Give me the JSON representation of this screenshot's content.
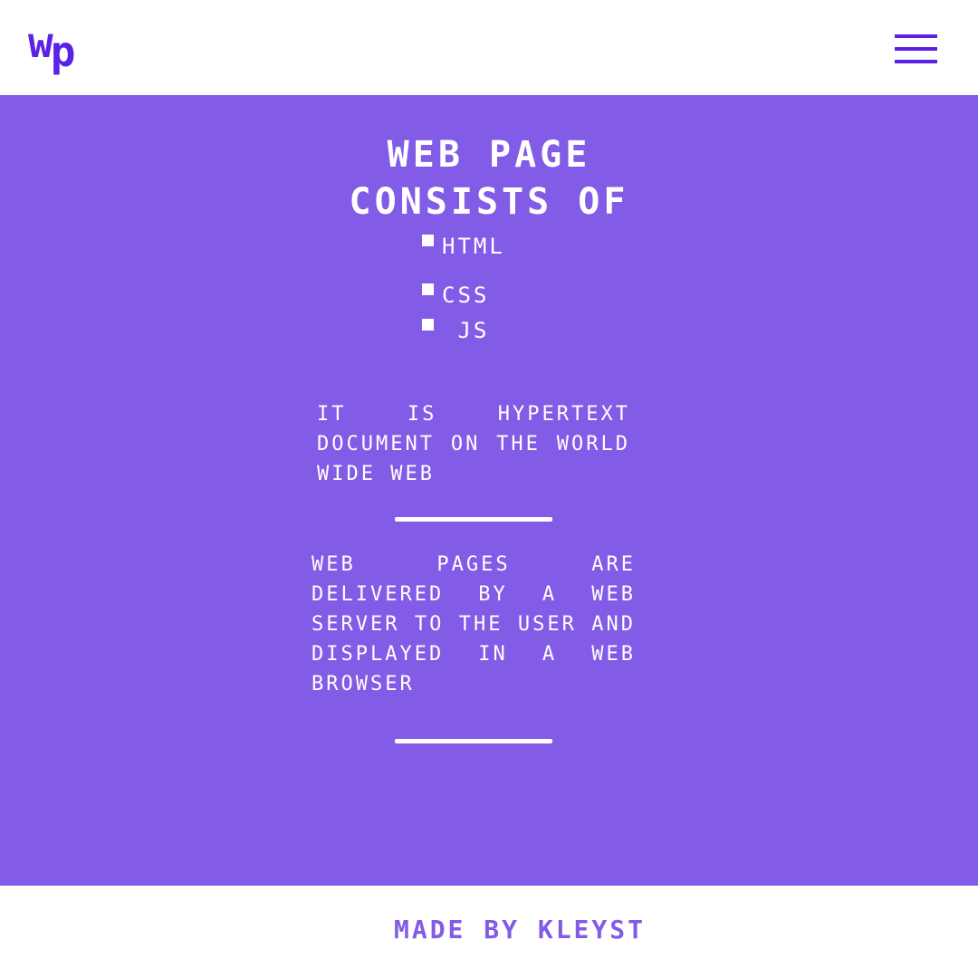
{
  "header": {
    "logo_w": "w",
    "logo_p": "p",
    "menu_icon": "hamburger-menu-icon"
  },
  "main": {
    "title_line1": "web page",
    "title_line2": "consists of",
    "list": [
      {
        "label": "html"
      },
      {
        "label": "css"
      },
      {
        "label": " js"
      }
    ],
    "paragraph1": "it is hypertext document on the world wide web",
    "paragraph2": "web pages are delivered by a web server to the user and displayed in a web browser"
  },
  "footer": {
    "credit": "made by kleyst"
  },
  "colors": {
    "accent": "#5b21e6",
    "main_bg": "#825be6",
    "text_light": "#ffffff"
  }
}
